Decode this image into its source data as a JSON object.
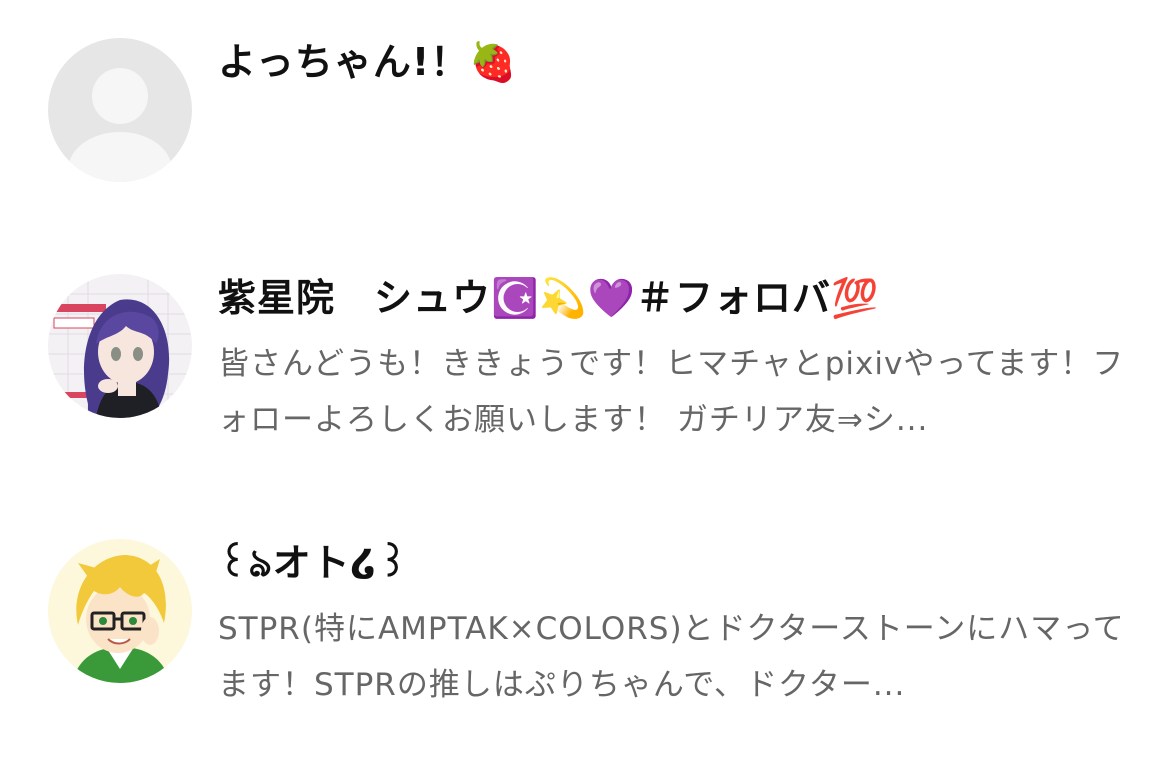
{
  "users": [
    {
      "name": "よっちゃん!！🍓",
      "bio": ""
    },
    {
      "name": "紫星院　シュウ☪️💫💜＃フォロバ💯",
      "bio": "皆さんどうも！ききょうです！ヒマチャとpixivやってます！フォローよろしくお願いします！ ガチリア友⇒シ..."
    },
    {
      "name": "꒰ঌオト໒꒱",
      "bio": "STPR(特にAMPTAK×COLORS)とドクターストーンにハマってます！STPRの推しはぷりちゃんで、ドクター..."
    }
  ]
}
